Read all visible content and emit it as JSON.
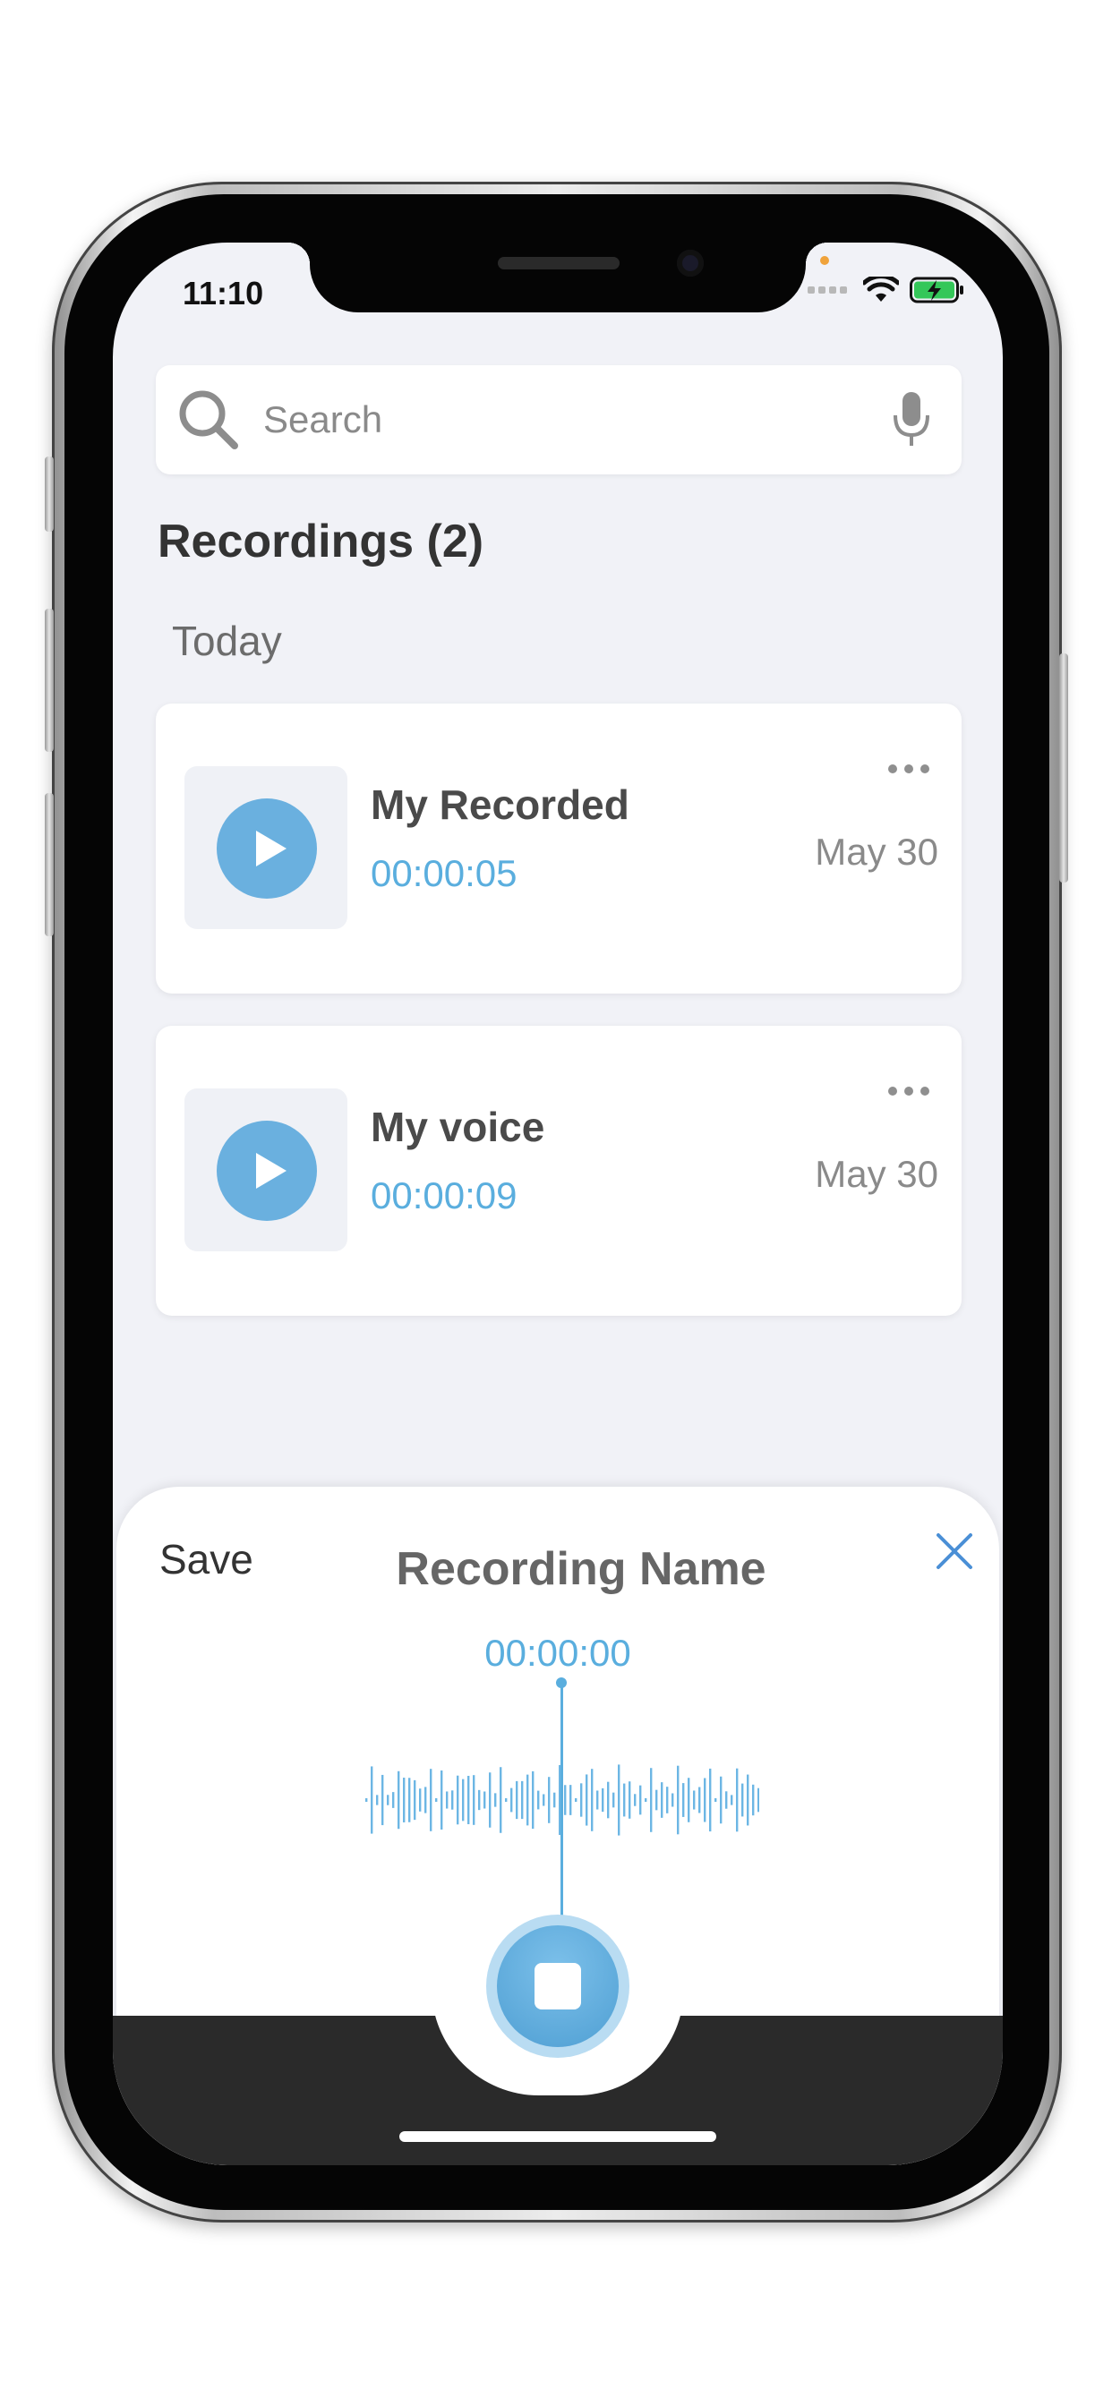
{
  "status_bar": {
    "time": "11:10"
  },
  "search": {
    "placeholder": "Search"
  },
  "recordings": {
    "heading": "Recordings (2)",
    "group_label": "Today",
    "items": [
      {
        "title": "My Recorded",
        "duration": "00:00:05",
        "date": "May 30"
      },
      {
        "title": "My voice",
        "duration": "00:00:09",
        "date": "May 30"
      }
    ]
  },
  "recorder": {
    "save_label": "Save",
    "title": "Recording Name",
    "timer": "00:00:00"
  },
  "colors": {
    "accent": "#5aaede",
    "play": "#6ab0df",
    "background": "#f1f2f7"
  },
  "icons": [
    "search-icon",
    "microphone-icon",
    "play-icon",
    "more-icon",
    "close-icon",
    "stop-icon",
    "wifi-icon",
    "battery-icon"
  ]
}
